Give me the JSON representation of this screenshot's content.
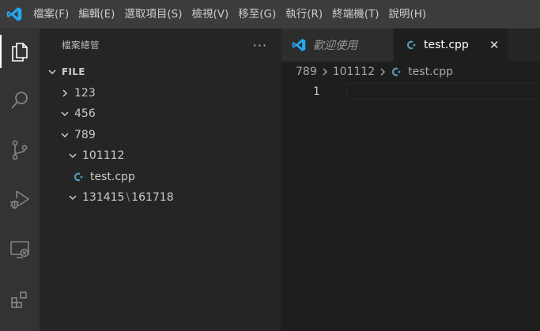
{
  "menu": [
    "檔案(F)",
    "編輯(E)",
    "選取項目(S)",
    "檢視(V)",
    "移至(G)",
    "執行(R)",
    "終端機(T)",
    "說明(H)"
  ],
  "sidebar": {
    "title": "檔案總管",
    "more": "···",
    "root": "FILE",
    "folder_123": "123",
    "folder_456": "456",
    "folder_789": "789",
    "folder_101112": "101112",
    "file_test": "test.cpp",
    "folder_compact_a": "131415",
    "folder_compact_sep": "\\",
    "folder_compact_b": "161718"
  },
  "tabs": [
    {
      "label": "歡迎使用"
    },
    {
      "label": "test.cpp",
      "close": "✕"
    }
  ],
  "breadcrumb": {
    "seg1": "789",
    "seg2": "101112",
    "seg3": "test.cpp"
  },
  "editor": {
    "line_number": "1"
  },
  "colors": {
    "vscode_blue": "#23a9f2",
    "cpp_icon": "#519aba"
  }
}
